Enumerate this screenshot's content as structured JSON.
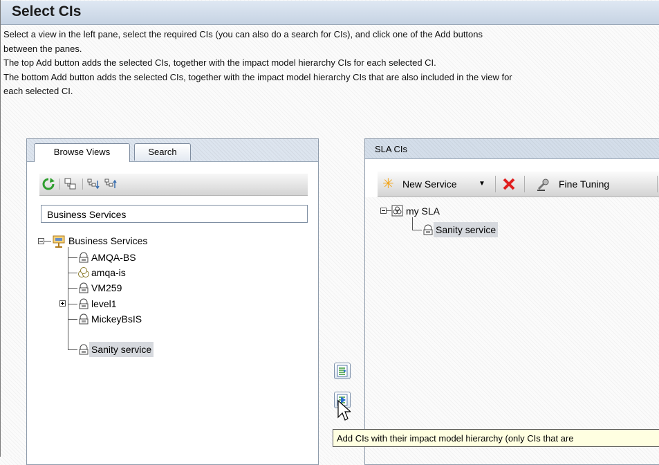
{
  "page": {
    "title": "Select CIs",
    "instructions": [
      "Select a view in the left pane, select the required CIs (you can also do a search for CIs), and click one of the Add buttons",
      "between the panes.",
      "The top Add button adds the selected CIs, together with the impact model hierarchy CIs for each selected CI.",
      "The bottom Add button adds the selected CIs, together with the impact model hierarchy CIs that are also included in the view for",
      "each selected CI."
    ]
  },
  "left_panel": {
    "tabs": [
      {
        "label": "Browse Views",
        "active": true
      },
      {
        "label": "Search",
        "active": false
      }
    ],
    "toolbar": {
      "icons": [
        "refresh-icon",
        "show-hierarchy-icon",
        "expand-all-icon",
        "collapse-all-icon"
      ]
    },
    "view_selector": {
      "value": "Business Services"
    },
    "tree": {
      "root": {
        "label": "Business Services",
        "icon": "business-services-view-icon",
        "expanded": true
      },
      "children": [
        {
          "label": "AMQA-BS",
          "icon": "business-service-icon"
        },
        {
          "label": "amqa-is",
          "icon": "infrastructure-service-icon"
        },
        {
          "label": "VM259",
          "icon": "business-service-icon"
        },
        {
          "label": "level1",
          "icon": "business-service-icon",
          "collapsed": true
        },
        {
          "label": "MickeyBsIS",
          "icon": "business-service-icon"
        },
        {
          "label": "Sanity service",
          "icon": "business-service-icon",
          "selected": true
        }
      ]
    }
  },
  "middle_buttons": {
    "add_with_hierarchy_icon": "add-cis-hierarchy-icon",
    "add_with_view_hierarchy_icon": "add-cis-view-hierarchy-icon"
  },
  "right_panel": {
    "header": "SLA CIs",
    "toolbar": {
      "new_service_label": "New Service",
      "delete_icon": "delete-icon",
      "fine_tuning_label": "Fine Tuning"
    },
    "tree": {
      "root": {
        "label": "my SLA",
        "icon": "sla-icon",
        "expanded": true
      },
      "children": [
        {
          "label": "Sanity service",
          "icon": "business-service-icon",
          "selected": true
        }
      ]
    }
  },
  "tooltip": {
    "text": "Add CIs with their impact model hierarchy (only CIs that are"
  },
  "colors": {
    "title_bar": "#c6d3e3",
    "selection": "#d6d9de",
    "tooltip_bg": "#ffffe1",
    "delete_red": "#e02020",
    "refresh_green": "#2e9e2e",
    "star_orange": "#f3a51a"
  }
}
